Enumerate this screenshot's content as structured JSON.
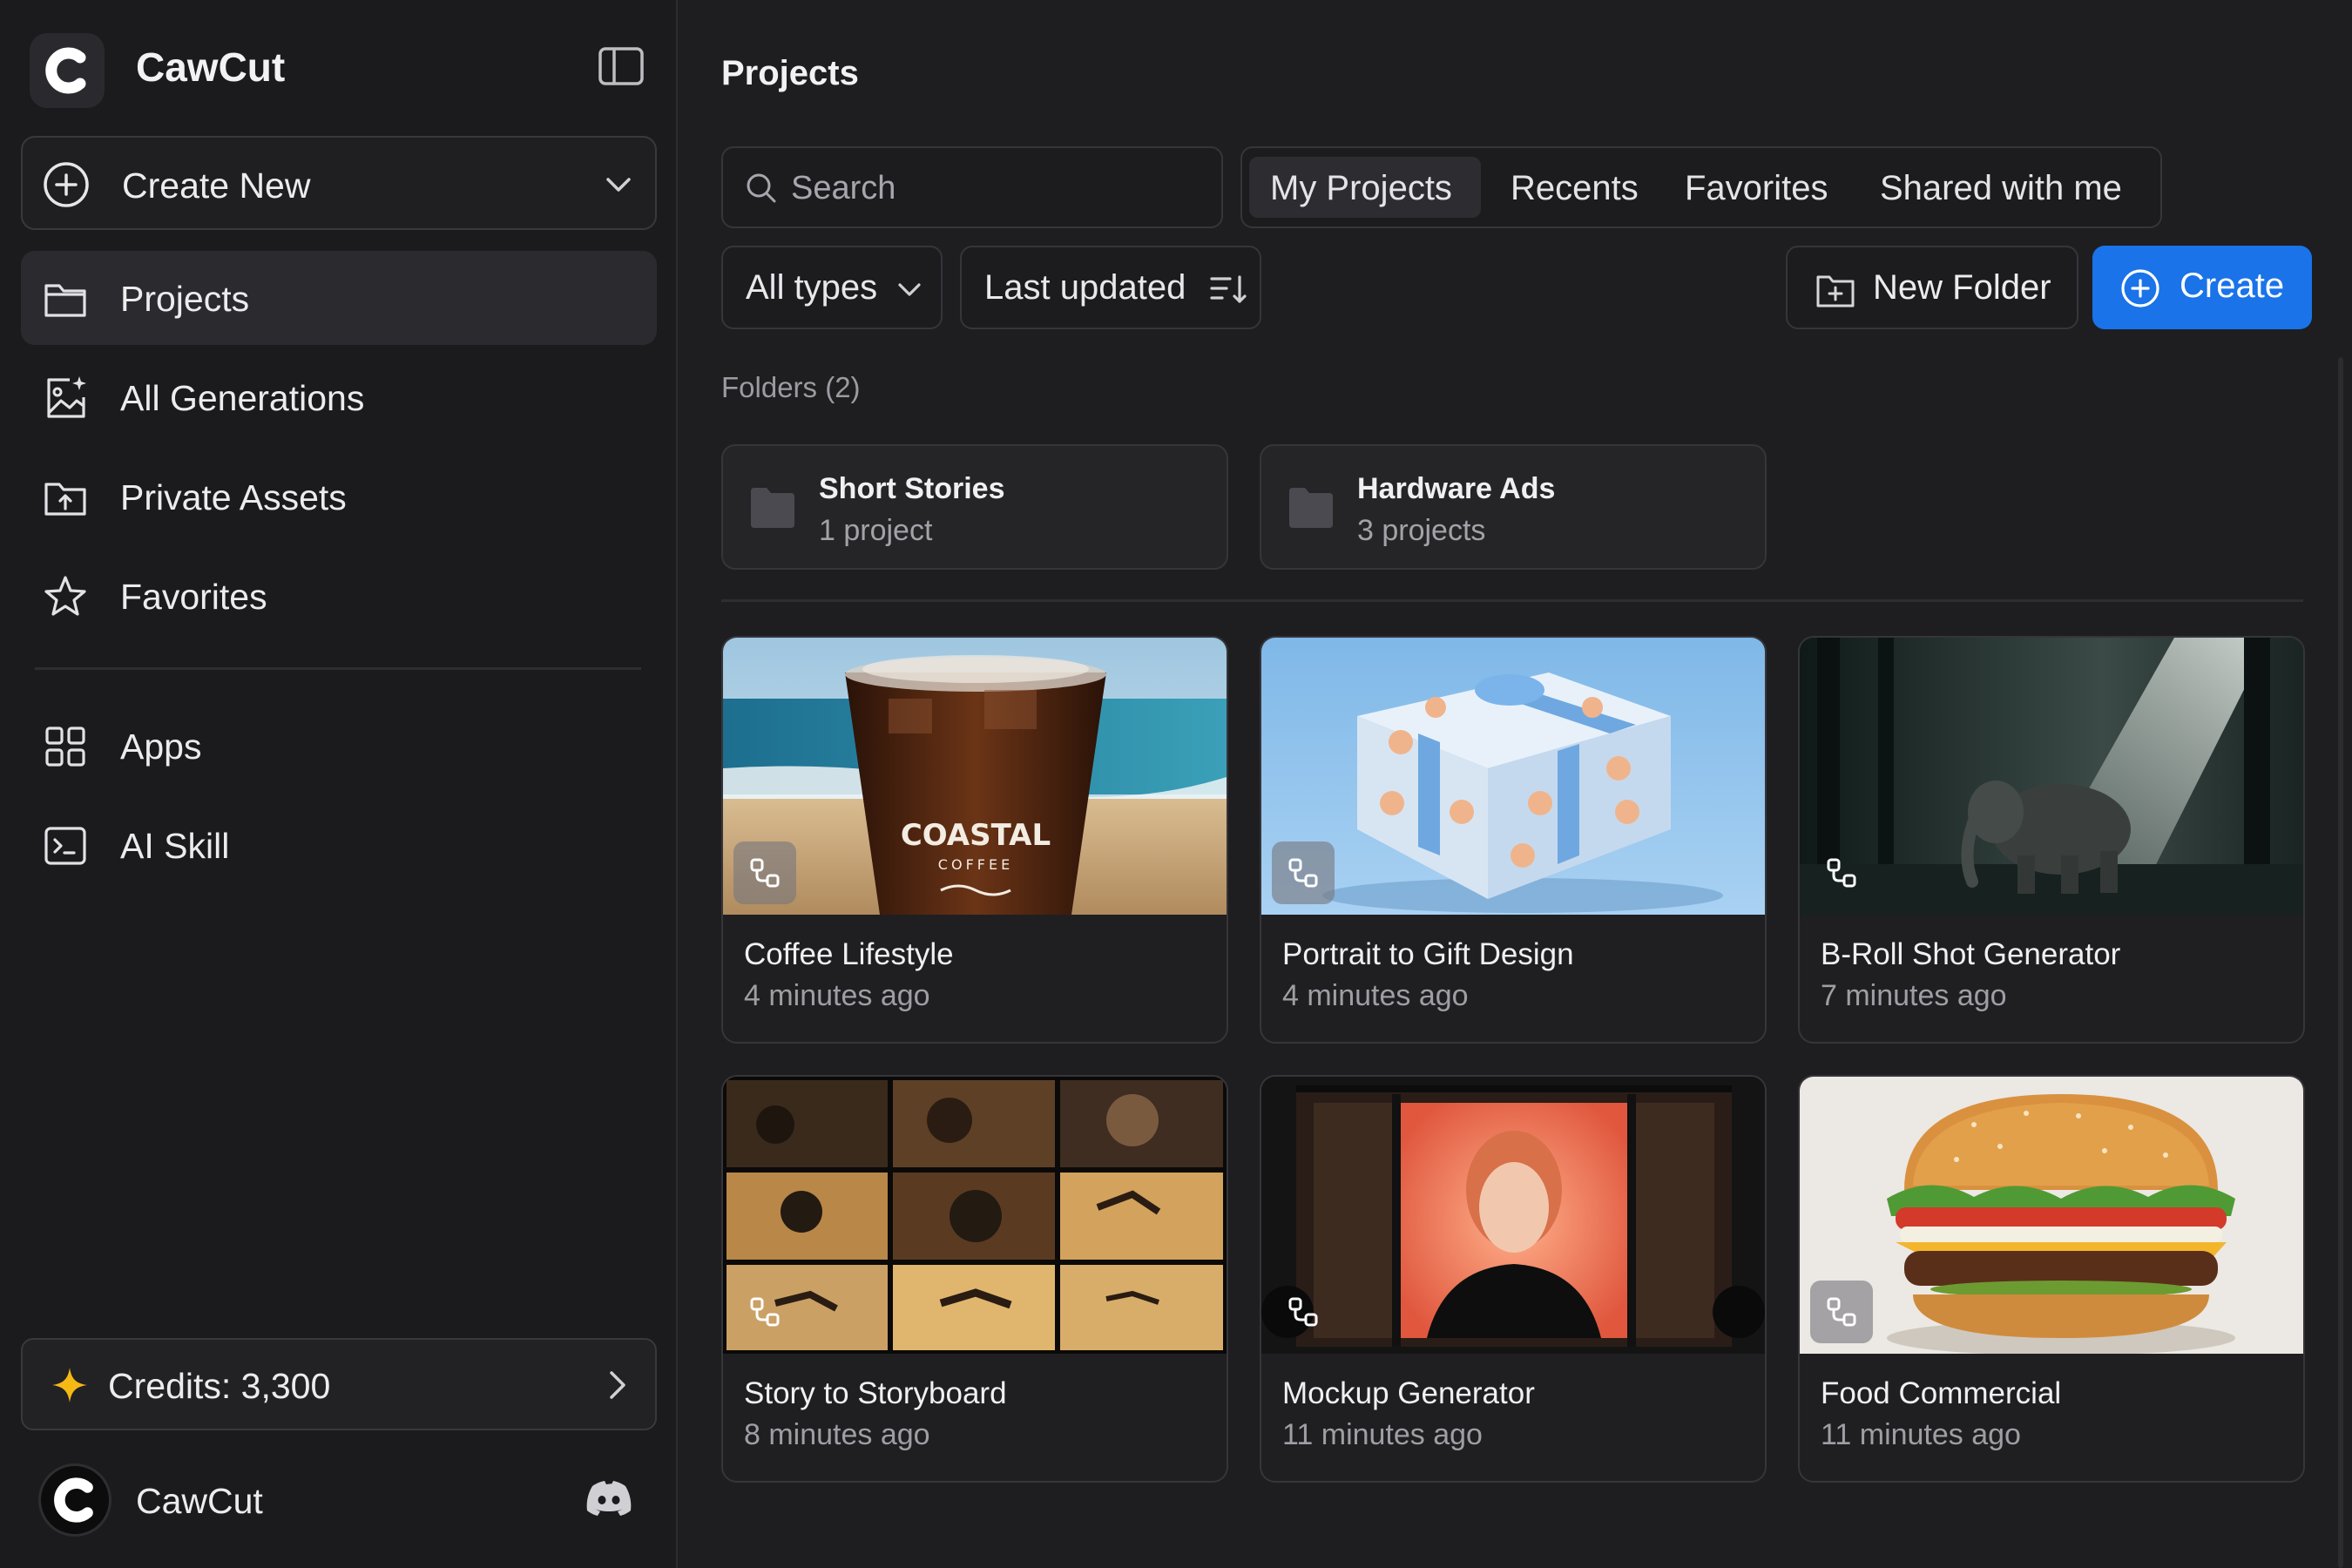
{
  "app": {
    "name": "CawCut"
  },
  "sidebar": {
    "create_new": {
      "label": "Create New"
    },
    "nav": [
      {
        "label": "Projects",
        "icon": "folder-icon",
        "active": true
      },
      {
        "label": "All Generations",
        "icon": "image-sparkle-icon"
      },
      {
        "label": "Private Assets",
        "icon": "folder-upload-icon"
      },
      {
        "label": "Favorites",
        "icon": "star-icon"
      },
      {
        "label": "Apps",
        "icon": "grid-icon"
      },
      {
        "label": "AI Skill",
        "icon": "terminal-icon"
      }
    ],
    "credits": {
      "label": "Credits: 3,300",
      "icon": "sparkle-icon",
      "icon_color": "#f5b914"
    },
    "account": {
      "name": "CawCut",
      "icon": "discord-icon"
    }
  },
  "main": {
    "title": "Projects",
    "search": {
      "placeholder": "Search",
      "value": ""
    },
    "tabs": [
      {
        "label": "My Projects",
        "active": true
      },
      {
        "label": "Recents"
      },
      {
        "label": "Favorites"
      },
      {
        "label": "Shared with me"
      }
    ],
    "filters": {
      "type": "All types",
      "sort": "Last updated"
    },
    "buttons": {
      "new_folder": "New Folder",
      "create": "Create"
    },
    "folders_heading": "Folders (2)",
    "folders": [
      {
        "name": "Short Stories",
        "count": "1 project"
      },
      {
        "name": "Hardware Ads",
        "count": "3 projects"
      }
    ],
    "projects": [
      {
        "title": "Coffee Lifestyle",
        "time": "4 minutes ago",
        "thumb_text": "COASTAL",
        "thumb_subtext": "COFFEE"
      },
      {
        "title": "Portrait to Gift Design",
        "time": "4 minutes ago"
      },
      {
        "title": "B-Roll Shot Generator",
        "time": "7 minutes ago"
      },
      {
        "title": "Story to Storyboard",
        "time": "8 minutes ago"
      },
      {
        "title": "Mockup Generator",
        "time": "11 minutes ago"
      },
      {
        "title": "Food Commercial",
        "time": "11 minutes ago"
      }
    ]
  },
  "colors": {
    "accent": "#1a73e8",
    "background": "#1e1e21",
    "sidebar": "#1b1b1e"
  }
}
